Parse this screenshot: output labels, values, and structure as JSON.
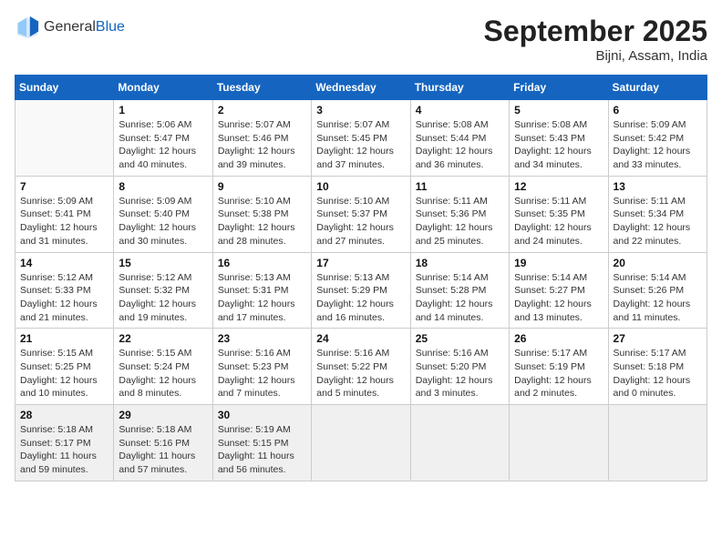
{
  "header": {
    "logo_general": "General",
    "logo_blue": "Blue",
    "month_title": "September 2025",
    "subtitle": "Bijni, Assam, India"
  },
  "weekdays": [
    "Sunday",
    "Monday",
    "Tuesday",
    "Wednesday",
    "Thursday",
    "Friday",
    "Saturday"
  ],
  "weeks": [
    [
      {
        "day": "",
        "empty": true
      },
      {
        "day": "1",
        "sunrise": "Sunrise: 5:06 AM",
        "sunset": "Sunset: 5:47 PM",
        "daylight": "Daylight: 12 hours and 40 minutes."
      },
      {
        "day": "2",
        "sunrise": "Sunrise: 5:07 AM",
        "sunset": "Sunset: 5:46 PM",
        "daylight": "Daylight: 12 hours and 39 minutes."
      },
      {
        "day": "3",
        "sunrise": "Sunrise: 5:07 AM",
        "sunset": "Sunset: 5:45 PM",
        "daylight": "Daylight: 12 hours and 37 minutes."
      },
      {
        "day": "4",
        "sunrise": "Sunrise: 5:08 AM",
        "sunset": "Sunset: 5:44 PM",
        "daylight": "Daylight: 12 hours and 36 minutes."
      },
      {
        "day": "5",
        "sunrise": "Sunrise: 5:08 AM",
        "sunset": "Sunset: 5:43 PM",
        "daylight": "Daylight: 12 hours and 34 minutes."
      },
      {
        "day": "6",
        "sunrise": "Sunrise: 5:09 AM",
        "sunset": "Sunset: 5:42 PM",
        "daylight": "Daylight: 12 hours and 33 minutes."
      }
    ],
    [
      {
        "day": "7",
        "sunrise": "Sunrise: 5:09 AM",
        "sunset": "Sunset: 5:41 PM",
        "daylight": "Daylight: 12 hours and 31 minutes."
      },
      {
        "day": "8",
        "sunrise": "Sunrise: 5:09 AM",
        "sunset": "Sunset: 5:40 PM",
        "daylight": "Daylight: 12 hours and 30 minutes."
      },
      {
        "day": "9",
        "sunrise": "Sunrise: 5:10 AM",
        "sunset": "Sunset: 5:38 PM",
        "daylight": "Daylight: 12 hours and 28 minutes."
      },
      {
        "day": "10",
        "sunrise": "Sunrise: 5:10 AM",
        "sunset": "Sunset: 5:37 PM",
        "daylight": "Daylight: 12 hours and 27 minutes."
      },
      {
        "day": "11",
        "sunrise": "Sunrise: 5:11 AM",
        "sunset": "Sunset: 5:36 PM",
        "daylight": "Daylight: 12 hours and 25 minutes."
      },
      {
        "day": "12",
        "sunrise": "Sunrise: 5:11 AM",
        "sunset": "Sunset: 5:35 PM",
        "daylight": "Daylight: 12 hours and 24 minutes."
      },
      {
        "day": "13",
        "sunrise": "Sunrise: 5:11 AM",
        "sunset": "Sunset: 5:34 PM",
        "daylight": "Daylight: 12 hours and 22 minutes."
      }
    ],
    [
      {
        "day": "14",
        "sunrise": "Sunrise: 5:12 AM",
        "sunset": "Sunset: 5:33 PM",
        "daylight": "Daylight: 12 hours and 21 minutes."
      },
      {
        "day": "15",
        "sunrise": "Sunrise: 5:12 AM",
        "sunset": "Sunset: 5:32 PM",
        "daylight": "Daylight: 12 hours and 19 minutes."
      },
      {
        "day": "16",
        "sunrise": "Sunrise: 5:13 AM",
        "sunset": "Sunset: 5:31 PM",
        "daylight": "Daylight: 12 hours and 17 minutes."
      },
      {
        "day": "17",
        "sunrise": "Sunrise: 5:13 AM",
        "sunset": "Sunset: 5:29 PM",
        "daylight": "Daylight: 12 hours and 16 minutes."
      },
      {
        "day": "18",
        "sunrise": "Sunrise: 5:14 AM",
        "sunset": "Sunset: 5:28 PM",
        "daylight": "Daylight: 12 hours and 14 minutes."
      },
      {
        "day": "19",
        "sunrise": "Sunrise: 5:14 AM",
        "sunset": "Sunset: 5:27 PM",
        "daylight": "Daylight: 12 hours and 13 minutes."
      },
      {
        "day": "20",
        "sunrise": "Sunrise: 5:14 AM",
        "sunset": "Sunset: 5:26 PM",
        "daylight": "Daylight: 12 hours and 11 minutes."
      }
    ],
    [
      {
        "day": "21",
        "sunrise": "Sunrise: 5:15 AM",
        "sunset": "Sunset: 5:25 PM",
        "daylight": "Daylight: 12 hours and 10 minutes."
      },
      {
        "day": "22",
        "sunrise": "Sunrise: 5:15 AM",
        "sunset": "Sunset: 5:24 PM",
        "daylight": "Daylight: 12 hours and 8 minutes."
      },
      {
        "day": "23",
        "sunrise": "Sunrise: 5:16 AM",
        "sunset": "Sunset: 5:23 PM",
        "daylight": "Daylight: 12 hours and 7 minutes."
      },
      {
        "day": "24",
        "sunrise": "Sunrise: 5:16 AM",
        "sunset": "Sunset: 5:22 PM",
        "daylight": "Daylight: 12 hours and 5 minutes."
      },
      {
        "day": "25",
        "sunrise": "Sunrise: 5:16 AM",
        "sunset": "Sunset: 5:20 PM",
        "daylight": "Daylight: 12 hours and 3 minutes."
      },
      {
        "day": "26",
        "sunrise": "Sunrise: 5:17 AM",
        "sunset": "Sunset: 5:19 PM",
        "daylight": "Daylight: 12 hours and 2 minutes."
      },
      {
        "day": "27",
        "sunrise": "Sunrise: 5:17 AM",
        "sunset": "Sunset: 5:18 PM",
        "daylight": "Daylight: 12 hours and 0 minutes."
      }
    ],
    [
      {
        "day": "28",
        "sunrise": "Sunrise: 5:18 AM",
        "sunset": "Sunset: 5:17 PM",
        "daylight": "Daylight: 11 hours and 59 minutes.",
        "last": true
      },
      {
        "day": "29",
        "sunrise": "Sunrise: 5:18 AM",
        "sunset": "Sunset: 5:16 PM",
        "daylight": "Daylight: 11 hours and 57 minutes.",
        "last": true
      },
      {
        "day": "30",
        "sunrise": "Sunrise: 5:19 AM",
        "sunset": "Sunset: 5:15 PM",
        "daylight": "Daylight: 11 hours and 56 minutes.",
        "last": true
      },
      {
        "day": "",
        "empty": true,
        "last": true
      },
      {
        "day": "",
        "empty": true,
        "last": true
      },
      {
        "day": "",
        "empty": true,
        "last": true
      },
      {
        "day": "",
        "empty": true,
        "last": true
      }
    ]
  ]
}
